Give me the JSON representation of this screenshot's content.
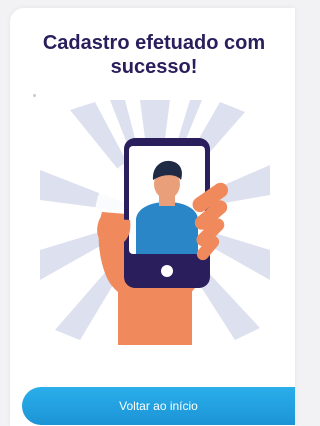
{
  "screen": {
    "title": "Cadastro efetuado com sucesso!",
    "illustration_icon": "hand-holding-phone-with-user-photo-icon",
    "button_label": "Voltar ao início"
  },
  "colors": {
    "title": "#2a1e5c",
    "button": "#1c94d6",
    "phone": "#2a1e5c",
    "hand": "#f08a5d",
    "shirt": "#2a86c6",
    "rays": "#dde0ee"
  }
}
